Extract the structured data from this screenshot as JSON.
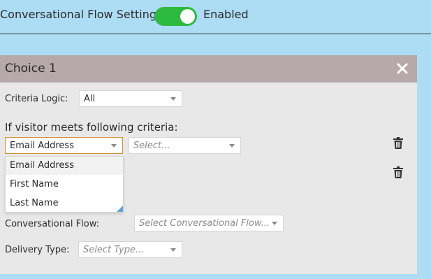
{
  "header": {
    "title": "Conversational Flow Settings",
    "toggle_label": "Enabled",
    "toggle_on": true
  },
  "choice": {
    "title": "Choice 1",
    "close_icon": "close-icon",
    "criteria_logic": {
      "label": "Criteria Logic:",
      "value": "All"
    },
    "criteria_heading": "If visitor meets following criteria:",
    "criteria_row": {
      "field_value": "Email Address",
      "operator_placeholder": "Select..."
    },
    "field_options": [
      "Email Address",
      "First Name",
      "Last Name"
    ],
    "conversational_flow": {
      "label": "Conversational Flow:",
      "placeholder": "Select Conversational Flow..."
    },
    "delivery_type": {
      "label": "Delivery Type:",
      "placeholder": "Select Type..."
    }
  },
  "colors": {
    "page_background": "#addcf5",
    "toggle_on": "#2cbb3f",
    "panel_header": "#b7a9a9",
    "panel_body": "#e8e8e8",
    "focus_border": "#d98c34"
  },
  "icons": [
    "close-icon",
    "trash-icon",
    "chevron-down-icon",
    "resize-grip-icon"
  ]
}
